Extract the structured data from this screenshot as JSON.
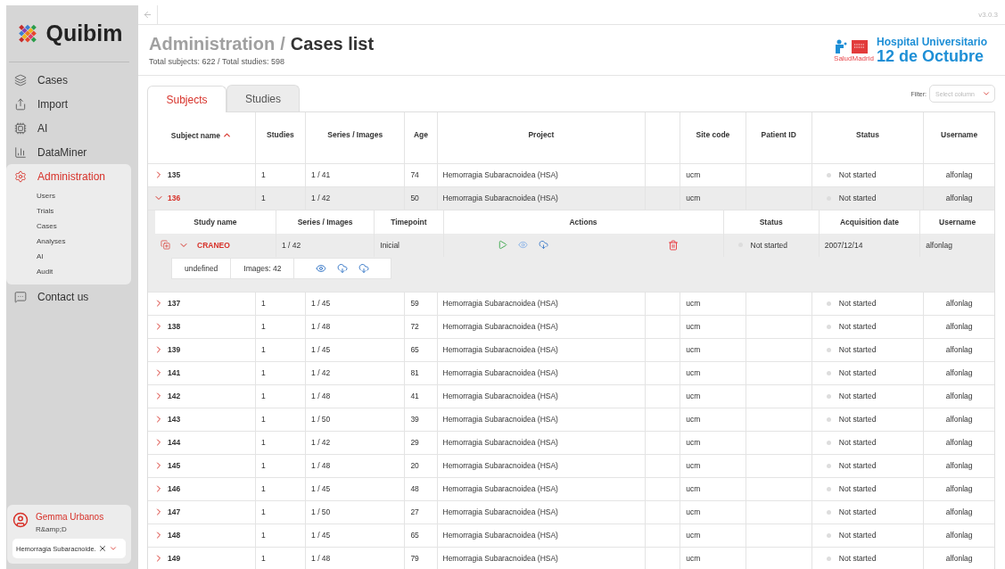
{
  "brand": {
    "name": "Quibim"
  },
  "nav": [
    {
      "label": "Cases",
      "selected": false
    },
    {
      "label": "Import",
      "selected": false
    },
    {
      "label": "AI",
      "selected": false
    },
    {
      "label": "DataMiner",
      "selected": false
    },
    {
      "label": "Administration",
      "selected": true,
      "children": [
        {
          "label": "Users"
        },
        {
          "label": "Trials"
        },
        {
          "label": "Cases"
        },
        {
          "label": "Analyses"
        },
        {
          "label": "AI"
        },
        {
          "label": "Audit"
        }
      ]
    },
    {
      "label": "Contact us",
      "selected": false
    }
  ],
  "user": {
    "name": "Gemma Urbanos",
    "role": "R&amp;D",
    "project": "Hemorragia Subaracnoide."
  },
  "version": "v3.0.3",
  "header": {
    "section": "Administration",
    "separator": "/",
    "page": "Cases list",
    "subtitle": "Total subjects: 622 / Total studies: 598"
  },
  "hospital": {
    "line1": "Hospital Universitario",
    "line2": "12 de Octubre",
    "brand": "SaludMadrid"
  },
  "tabs": [
    {
      "label": "Subjects",
      "selected": true
    },
    {
      "label": "Studies",
      "selected": false
    }
  ],
  "filter": {
    "label": "Filter:",
    "placeholder": "Select column"
  },
  "table": {
    "columns": [
      "Subject name",
      "Studies",
      "Series / Images",
      "Age",
      "Project",
      "",
      "Site code",
      "Patient ID",
      "Status",
      "Username"
    ],
    "rows": [
      {
        "name": "135",
        "studies": "1",
        "series": "1 / 41",
        "age": "74",
        "project": "Hemorragia Subaracnoidea (HSA)",
        "site": "ucm",
        "status": "Not started",
        "username": "alfonlag",
        "expanded": false
      },
      {
        "name": "136",
        "studies": "1",
        "series": "1 / 42",
        "age": "50",
        "project": "Hemorragia Subaracnoidea (HSA)",
        "site": "ucm",
        "status": "Not started",
        "username": "alfonlag",
        "expanded": true
      },
      {
        "name": "137",
        "studies": "1",
        "series": "1 / 45",
        "age": "59",
        "project": "Hemorragia Subaracnoidea (HSA)",
        "site": "ucm",
        "status": "Not started",
        "username": "alfonlag",
        "expanded": false
      },
      {
        "name": "138",
        "studies": "1",
        "series": "1 / 48",
        "age": "72",
        "project": "Hemorragia Subaracnoidea (HSA)",
        "site": "ucm",
        "status": "Not started",
        "username": "alfonlag",
        "expanded": false
      },
      {
        "name": "139",
        "studies": "1",
        "series": "1 / 45",
        "age": "65",
        "project": "Hemorragia Subaracnoidea (HSA)",
        "site": "ucm",
        "status": "Not started",
        "username": "alfonlag",
        "expanded": false
      },
      {
        "name": "141",
        "studies": "1",
        "series": "1 / 42",
        "age": "81",
        "project": "Hemorragia Subaracnoidea (HSA)",
        "site": "ucm",
        "status": "Not started",
        "username": "alfonlag",
        "expanded": false
      },
      {
        "name": "142",
        "studies": "1",
        "series": "1 / 48",
        "age": "41",
        "project": "Hemorragia Subaracnoidea (HSA)",
        "site": "ucm",
        "status": "Not started",
        "username": "alfonlag",
        "expanded": false
      },
      {
        "name": "143",
        "studies": "1",
        "series": "1 / 50",
        "age": "39",
        "project": "Hemorragia Subaracnoidea (HSA)",
        "site": "ucm",
        "status": "Not started",
        "username": "alfonlag",
        "expanded": false
      },
      {
        "name": "144",
        "studies": "1",
        "series": "1 / 42",
        "age": "29",
        "project": "Hemorragia Subaracnoidea (HSA)",
        "site": "ucm",
        "status": "Not started",
        "username": "alfonlag",
        "expanded": false
      },
      {
        "name": "145",
        "studies": "1",
        "series": "1 / 48",
        "age": "20",
        "project": "Hemorragia Subaracnoidea (HSA)",
        "site": "ucm",
        "status": "Not started",
        "username": "alfonlag",
        "expanded": false
      },
      {
        "name": "146",
        "studies": "1",
        "series": "1 / 45",
        "age": "48",
        "project": "Hemorragia Subaracnoidea (HSA)",
        "site": "ucm",
        "status": "Not started",
        "username": "alfonlag",
        "expanded": false
      },
      {
        "name": "147",
        "studies": "1",
        "series": "1 / 50",
        "age": "27",
        "project": "Hemorragia Subaracnoidea (HSA)",
        "site": "ucm",
        "status": "Not started",
        "username": "alfonlag",
        "expanded": false
      },
      {
        "name": "148",
        "studies": "1",
        "series": "1 / 45",
        "age": "65",
        "project": "Hemorragia Subaracnoidea (HSA)",
        "site": "ucm",
        "status": "Not started",
        "username": "alfonlag",
        "expanded": false
      },
      {
        "name": "149",
        "studies": "1",
        "series": "1 / 48",
        "age": "79",
        "project": "Hemorragia Subaracnoidea (HSA)",
        "site": "ucm",
        "status": "Not started",
        "username": "alfonlag",
        "expanded": false
      }
    ]
  },
  "study_table": {
    "columns": [
      "Study name",
      "Series / Images",
      "Timepoint",
      "Actions",
      "Status",
      "Acquisition date",
      "Username"
    ],
    "rows": [
      {
        "name": "CRANEO",
        "series": "1 / 42",
        "timepoint": "Inicial",
        "status": "Not started",
        "date": "2007/12/14",
        "username": "alfonlag",
        "expanded": true,
        "series_rows": [
          {
            "description": "undefined",
            "images": "Images: 42"
          }
        ]
      }
    ]
  }
}
